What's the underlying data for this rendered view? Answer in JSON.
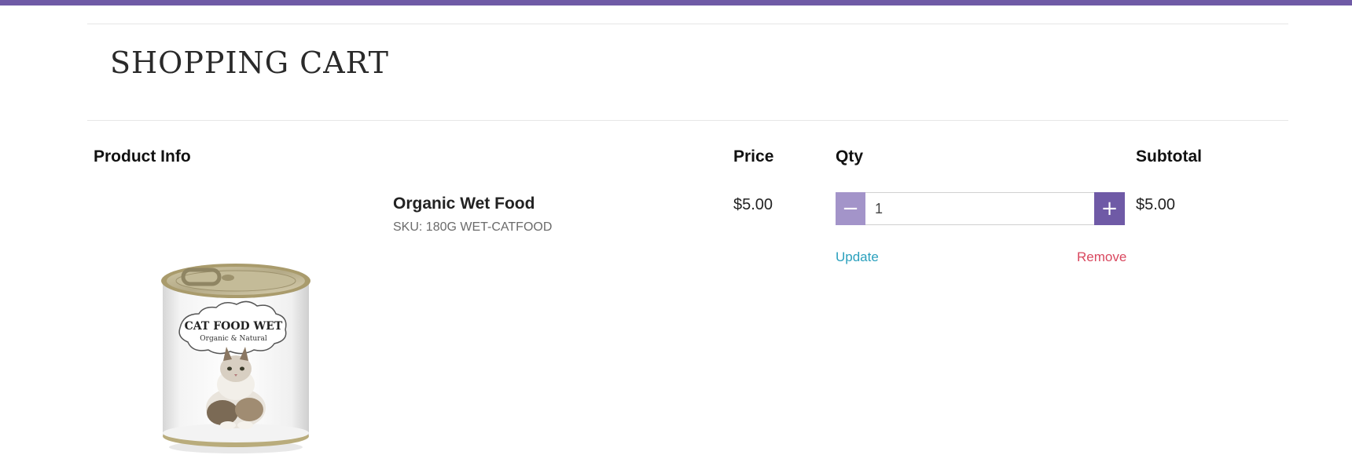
{
  "cart": {
    "title": "SHOPPING CART",
    "headers": {
      "product_info": "Product Info",
      "price": "Price",
      "qty": "Qty",
      "subtotal": "Subtotal"
    },
    "items": [
      {
        "name": "Organic Wet Food",
        "sku": "SKU: 180G WET-CATFOOD",
        "price": "$5.00",
        "qty": "1",
        "subtotal": "$5.00",
        "minus_label": "−",
        "plus_label": "+",
        "update_label": "Update",
        "remove_label": "Remove",
        "image": {
          "icon": "cat-food-can-image",
          "label_line1": "CAT FOOD WET",
          "label_line2": "Organic & Natural"
        }
      }
    ]
  },
  "colors": {
    "brand": "#6f5aa6",
    "brand_light": "#a394c9",
    "link": "#2aa0bd",
    "danger": "#d9485f"
  }
}
